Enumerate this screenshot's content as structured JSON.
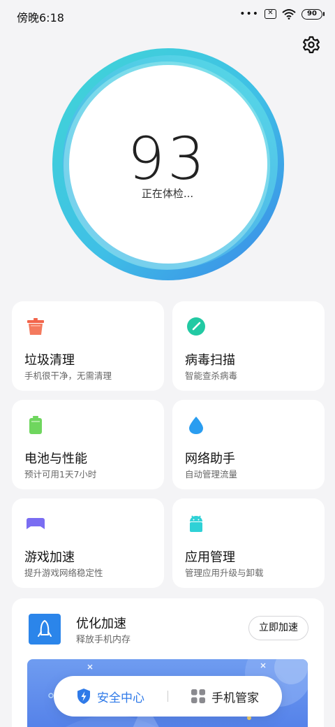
{
  "status_bar": {
    "time": "傍晚6:18",
    "dots": "•••",
    "sim_icon": "✕",
    "battery": "90"
  },
  "score": {
    "value": "93",
    "status": "正在体检..."
  },
  "cards": [
    {
      "title": "垃圾清理",
      "subtitle": "手机很干净，无需清理",
      "icon": "trash-icon",
      "color": "#f2644a"
    },
    {
      "title": "病毒扫描",
      "subtitle": "智能查杀病毒",
      "icon": "virus-scan-icon",
      "color": "#22c9a3"
    },
    {
      "title": "电池与性能",
      "subtitle": "预计可用1天7小时",
      "icon": "battery-icon",
      "color": "#6fd65e"
    },
    {
      "title": "网络助手",
      "subtitle": "自动管理流量",
      "icon": "droplet-icon",
      "color": "#2a9df0"
    },
    {
      "title": "游戏加速",
      "subtitle": "提升游戏网络稳定性",
      "icon": "gamepad-icon",
      "color": "#7a6df2"
    },
    {
      "title": "应用管理",
      "subtitle": "管理应用升级与卸载",
      "icon": "android-icon",
      "color": "#2fd1d6"
    }
  ],
  "optimize": {
    "title": "优化加速",
    "subtitle": "释放手机内存",
    "button": "立即加速"
  },
  "nav": {
    "security": "安全中心",
    "manager": "手机管家"
  },
  "colors": {
    "accent": "#2f7ae8",
    "ring_start": "#3fd3d8",
    "ring_end": "#3a8fe8"
  }
}
